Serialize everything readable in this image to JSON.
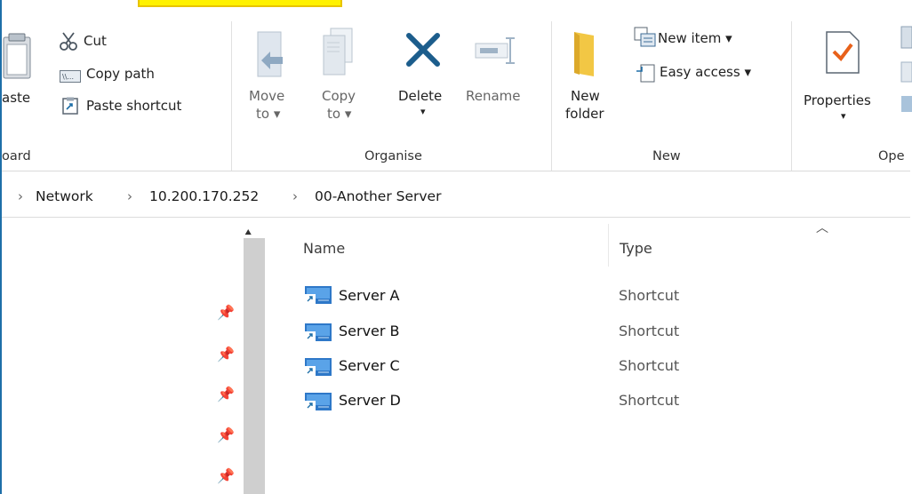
{
  "clipboard": {
    "paste": "aste",
    "cut": "Cut",
    "copy_path": "Copy path",
    "paste_shortcut": "Paste shortcut",
    "group_label": "oard"
  },
  "organise": {
    "move_to": [
      "Move",
      "to ▾"
    ],
    "copy_to": [
      "Copy",
      "to ▾"
    ],
    "delete": "Delete",
    "delete_caret": "▾",
    "rename": "Rename",
    "group_label": "Organise"
  },
  "new_group": {
    "new_folder": [
      "New",
      "folder"
    ],
    "new_item": "New item ▾",
    "easy_access": "Easy access ▾",
    "group_label": "New"
  },
  "open_group": {
    "properties": "Properties",
    "properties_caret": "▾",
    "group_label": "Ope"
  },
  "address": {
    "crumbs": [
      "Network",
      "10.200.170.252",
      "00-Another Server"
    ]
  },
  "columns": {
    "name": "Name",
    "type": "Type"
  },
  "files": [
    {
      "name": "Server A",
      "type": "Shortcut"
    },
    {
      "name": "Server B",
      "type": "Shortcut"
    },
    {
      "name": "Server C",
      "type": "Shortcut"
    },
    {
      "name": "Server D",
      "type": "Shortcut"
    }
  ],
  "colors": {
    "accent": "#1e6fa8",
    "highlight": "#fff200",
    "folder": "#f2c744",
    "delete_x": "#1c5d8c"
  }
}
